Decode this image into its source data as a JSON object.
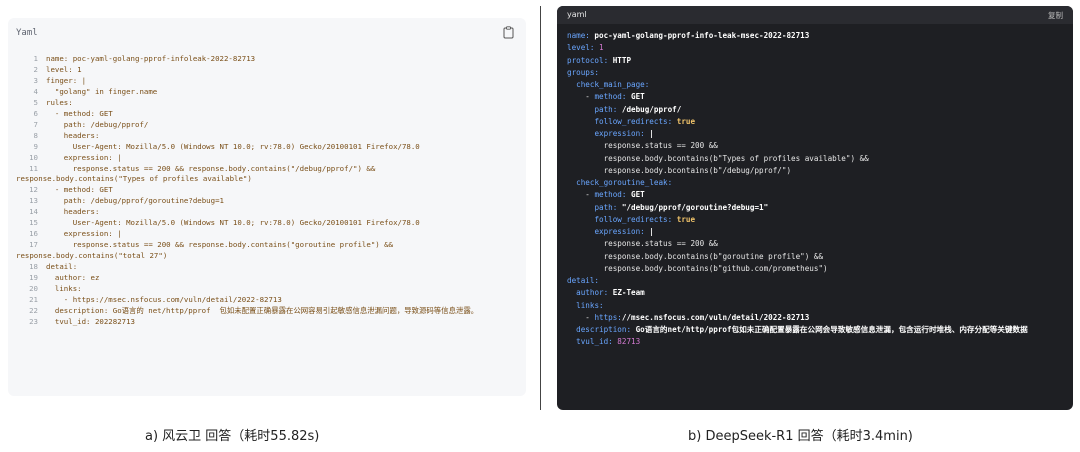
{
  "left_panel": {
    "header": "Yaml",
    "copy_icon": "clipboard-icon",
    "lines": [
      {
        "n": "1",
        "t": "name: poc-yaml-golang-pprof-infoleak-2022-82713"
      },
      {
        "n": "2",
        "t": "level: 1"
      },
      {
        "n": "3",
        "t": "finger: |"
      },
      {
        "n": "4",
        "t": "  \"golang\" in finger.name"
      },
      {
        "n": "5",
        "t": "rules:"
      },
      {
        "n": "6",
        "t": "  - method: GET"
      },
      {
        "n": "7",
        "t": "    path: /debug/pprof/"
      },
      {
        "n": "8",
        "t": "    headers:"
      },
      {
        "n": "9",
        "t": "      User-Agent: Mozilla/5.0 (Windows NT 10.0; rv:78.0) Gecko/20100101 Firefox/78.0"
      },
      {
        "n": "10",
        "t": "    expression: |"
      },
      {
        "n": "11",
        "t": "      response.status == 200 && response.body.contains(\"/debug/pprof/\") &&"
      },
      {
        "n": "",
        "t": "response.body.contains(\"Types of profiles available\")"
      },
      {
        "n": "12",
        "t": "  - method: GET"
      },
      {
        "n": "13",
        "t": "    path: /debug/pprof/goroutine?debug=1"
      },
      {
        "n": "14",
        "t": "    headers:"
      },
      {
        "n": "15",
        "t": "      User-Agent: Mozilla/5.0 (Windows NT 10.0; rv:78.0) Gecko/20100101 Firefox/78.0"
      },
      {
        "n": "16",
        "t": "    expression: |"
      },
      {
        "n": "17",
        "t": "      response.status == 200 && response.body.contains(\"goroutine profile\") &&"
      },
      {
        "n": "",
        "t": "response.body.contains(\"total 27\")"
      },
      {
        "n": "18",
        "t": "detail:"
      },
      {
        "n": "19",
        "t": "  author: ez"
      },
      {
        "n": "20",
        "t": "  links:"
      },
      {
        "n": "21",
        "t": "    - https://msec.nsfocus.com/vuln/detail/2022-82713"
      },
      {
        "n": "22",
        "t": "  description: Go语言的 net/http/pprof  包如未配置正确暴露在公网容易引起敏感信息泄漏问题，导致源码等信息泄露。"
      },
      {
        "n": "23",
        "t": "  tvul_id: 202282713"
      }
    ]
  },
  "right_panel": {
    "title": "yaml",
    "copy_label": "复制",
    "lines": [
      "name: poc-yaml-golang-pprof-info-leak-msec-2022-82713",
      "level: 1",
      "protocol: HTTP",
      "groups:",
      "  check_main_page:",
      "    - method: GET",
      "      path: /debug/pprof/",
      "      follow_redirects: true",
      "      expression: |",
      "        response.status == 200 &&",
      "        response.body.bcontains(b\"Types of profiles available\") &&",
      "        response.body.bcontains(b\"/debug/pprof/\")",
      "  check_goroutine_leak:",
      "    - method: GET",
      "      path: \"/debug/pprof/goroutine?debug=1\"",
      "      follow_redirects: true",
      "      expression: |",
      "        response.status == 200 &&",
      "        response.body.bcontains(b\"goroutine profile\") &&",
      "        response.body.bcontains(b\"github.com/prometheus\")",
      "detail:",
      "  author: EZ-Team",
      "  links:",
      "    - https://msec.nsfocus.com/vuln/detail/2022-82713",
      "  description: Go语言的net/http/pprof包如未正确配置暴露在公网会导致敏感信息泄漏，包含运行时堆栈、内存分配等关键数据",
      "  tvul_id: 82713"
    ]
  },
  "captions": {
    "a": "a) 风云卫 回答（耗时55.82s)",
    "b": "b) DeepSeek-R1 回答（耗时3.4min)"
  }
}
